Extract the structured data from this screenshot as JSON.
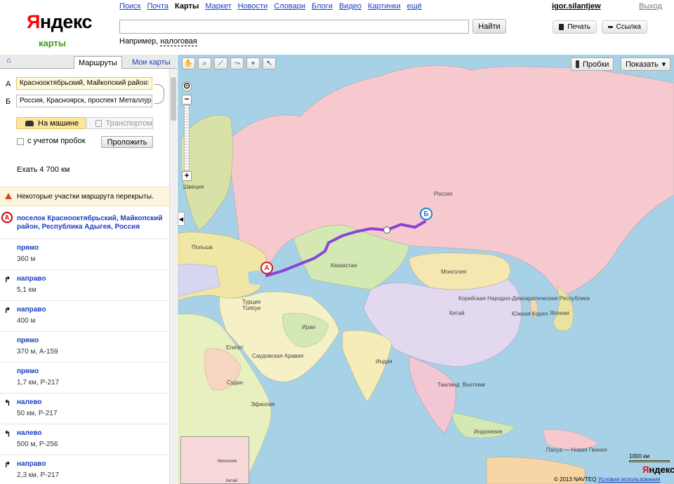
{
  "header": {
    "logo_first": "Я",
    "logo_rest": "ндекс",
    "logo_sub": "карты",
    "nav": [
      "Поиск",
      "Почта",
      "Карты",
      "Маркет",
      "Новости",
      "Словари",
      "Блоги",
      "Видео",
      "Картинки",
      "ещё"
    ],
    "nav_active": "Карты",
    "user": "igor.silantjew",
    "logout": "Выход",
    "search_value": "",
    "search_button": "Найти",
    "example_prefix": "Например,",
    "example_link": "налоговая",
    "print_button": "Печать",
    "link_button": "Ссылка"
  },
  "panel": {
    "tab_routes": "Маршруты",
    "tab_my_maps": "Мои карты",
    "label_a": "А",
    "label_b": "Б",
    "from_value": "Краснооктябрьский, Майкопский район",
    "to_value": "Россия, Красноярск, проспект Металлургов",
    "mode_car": "На машине",
    "mode_transport": "Транспортом",
    "traffic_label": "с учетом пробок",
    "build_button": "Проложить",
    "distance": "Ехать 4 700 км",
    "warning": "Некоторые участки маршрута перекрыты.",
    "start_marker": "А",
    "start_place": "поселок Краснооктябрьский, Майкопский район, Республика Адыгея, Россия",
    "steps": [
      {
        "action": "прямо",
        "info": "360 м",
        "dir": "straight"
      },
      {
        "action": "направо",
        "info": "5,1 км",
        "dir": "right"
      },
      {
        "action": "направо",
        "info": "400 м",
        "dir": "right"
      },
      {
        "action": "прямо",
        "info": "370 м, А-159",
        "dir": "straight"
      },
      {
        "action": "прямо",
        "info": "1,7 км, Р-217",
        "dir": "straight"
      },
      {
        "action": "налево",
        "info": "50 км, Р-217",
        "dir": "left"
      },
      {
        "action": "налево",
        "info": "500 м, Р-256",
        "dir": "left"
      },
      {
        "action": "направо",
        "info": "2,3 км, Р-217",
        "dir": "right"
      }
    ]
  },
  "map": {
    "traffic_button": "Пробки",
    "show_button": "Показать",
    "marker_a": "А",
    "marker_b": "Б",
    "labels": {
      "russia": "Россия",
      "sweden": "Швеция",
      "poland": "Польша",
      "kazakhstan": "Казахстан",
      "mongolia": "Монголия",
      "north_korea": "Корейская Народно-Демократическая Республика",
      "china": "Китай",
      "japan": "Япония",
      "south_korea": "Южная Корея",
      "turkey": "Турция",
      "turkey_local": "Türkiye",
      "iran": "Иран",
      "egypt": "Египет",
      "saudi": "Саудовская Аравия",
      "india": "Индия",
      "thailand": "Таиланд",
      "vietnam": "Вьетнам",
      "sudan": "Судан",
      "ethiopia": "Эфиопия",
      "indonesia": "Индонезия",
      "papua": "Папуа — Новая Гвинея"
    },
    "minimap_label_1": "Монголия",
    "minimap_label_2": "Китай",
    "scale_label": "1000 км",
    "brand_first": "Я",
    "brand_rest": "ндекс",
    "copyright": "© 2013 NAVTEQ",
    "terms": "Условия использования",
    "colors": {
      "sea": "#a7d1e6",
      "russia": "#f5c8cd",
      "route": "#8a44d6"
    }
  }
}
